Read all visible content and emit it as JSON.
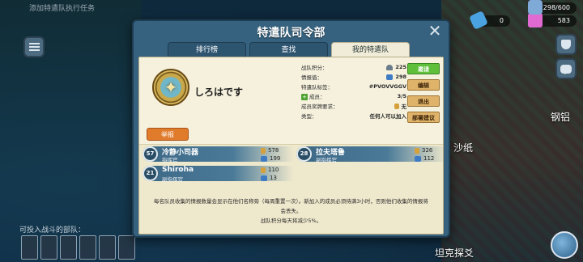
{
  "background": {
    "top_hint": "添加特遣队执行任务",
    "map_labels": [
      "钢铝",
      "沙纸",
      "坦克探爻"
    ],
    "resources": [
      {
        "icon": "blue-crystal-icon",
        "value": "0",
        "color": "#4aa3e0"
      },
      {
        "icon": "pink-gem-icon",
        "value": "583",
        "color": "#e06ad1"
      },
      {
        "icon": "intel-card-icon",
        "value": "298/600",
        "color": "#7fa9d6"
      }
    ],
    "squad_label": "可投入战斗的部队：",
    "squad_slots": 6
  },
  "panel": {
    "title": "特遣队司令部",
    "tabs": [
      "排行榜",
      "查找",
      "我的特遣队"
    ],
    "active_tab": 2,
    "team": {
      "name": "しろはです",
      "join_label": "举报",
      "stats": [
        {
          "label": "战队积分：",
          "value": "225",
          "icon": "helmet-icon"
        },
        {
          "label": "情报值：",
          "value": "298",
          "icon": "intel-icon"
        },
        {
          "label": "特遣队标签：",
          "value": "#PVOVVGGV",
          "icon": ""
        },
        {
          "label": "成员：",
          "value": "3/5",
          "icon": "plus-icon"
        },
        {
          "label": "成员奖牌要求：",
          "value": "无",
          "icon": "medal-icon"
        },
        {
          "label": "类型：",
          "value": "任何人可以加入",
          "icon": ""
        }
      ],
      "actions": [
        {
          "label": "邀请",
          "style": "green"
        },
        {
          "label": "编辑",
          "style": "orange"
        },
        {
          "label": "退出",
          "style": "orange"
        },
        {
          "label": "部署建议",
          "style": "orange"
        }
      ]
    },
    "members": [
      {
        "num": "57",
        "name": "冷静小司器",
        "rank": "指挥官",
        "medals": "578",
        "intel": "199"
      },
      {
        "num": "28",
        "name": "拉夫塔鲁",
        "rank": "副指挥官",
        "medals": "326",
        "intel": "112"
      },
      {
        "num": "21",
        "name": "Shiroha",
        "rank": "副指挥官",
        "medals": "110",
        "intel": "13"
      }
    ],
    "notes": [
      "每名队员收集的情报数量会显示在他们名称旁（每周重置一次）。新加入的成员必须待满3小时，否则他们收集的情报将会丢失。",
      "战队积分每天将减少5%。"
    ]
  }
}
